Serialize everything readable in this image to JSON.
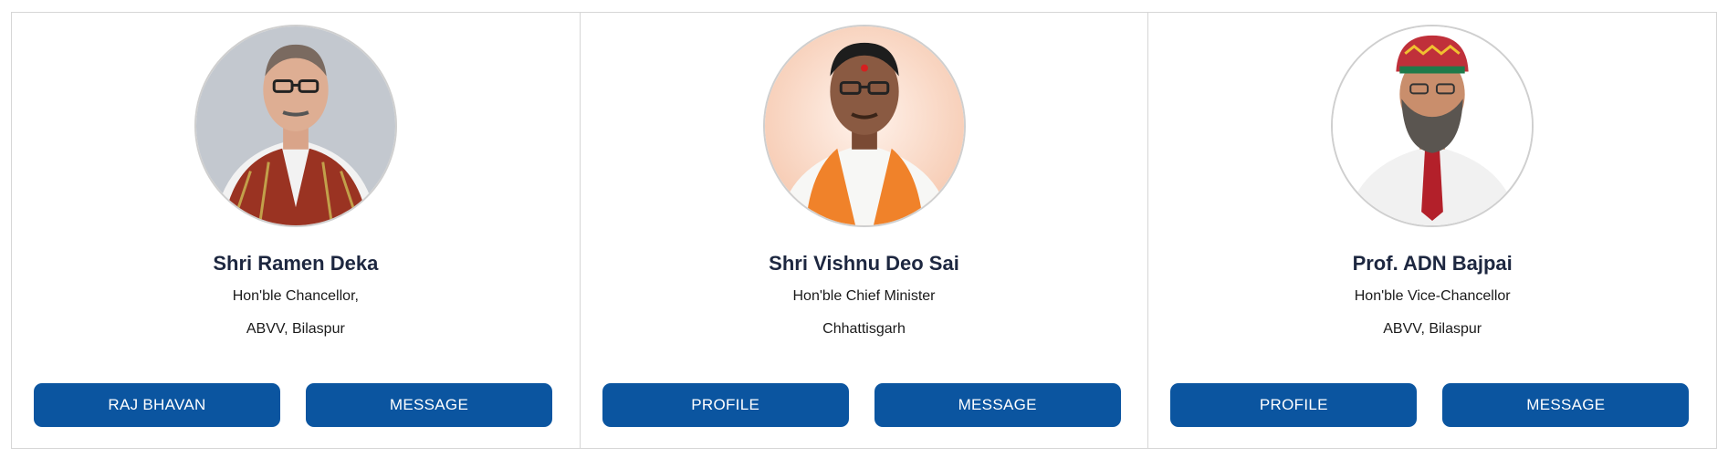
{
  "cards": [
    {
      "name": "Shri Ramen Deka",
      "line1": "Hon'ble Chancellor,",
      "line2": "ABVV, Bilaspur",
      "button_left": "RAJ BHAVAN",
      "button_right": "MESSAGE"
    },
    {
      "name": "Shri Vishnu Deo Sai",
      "line1": "Hon'ble Chief Minister",
      "line2": "Chhattisgarh",
      "button_left": "PROFILE",
      "button_right": "MESSAGE"
    },
    {
      "name": "Prof. ADN Bajpai",
      "line1": "Hon'ble Vice-Chancellor",
      "line2": "ABVV, Bilaspur",
      "button_left": "PROFILE",
      "button_right": "MESSAGE"
    }
  ],
  "colors": {
    "button_bg": "#0b55a0",
    "name_text": "#1d2740"
  }
}
